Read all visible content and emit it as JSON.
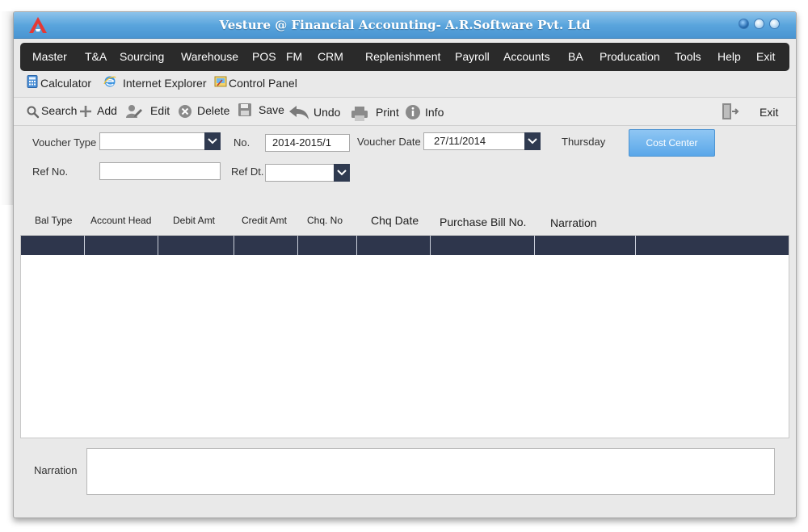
{
  "window": {
    "title": "Vesture @ Financial Accounting- A.R.Software Pvt. Ltd"
  },
  "menu": {
    "items": [
      "Master",
      "T&A",
      "Sourcing",
      "Warehouse",
      "POS",
      "FM",
      "CRM",
      "Replenishment",
      "Payroll",
      "Accounts",
      "BA",
      "Producation",
      "Tools",
      "Help",
      "Exit"
    ]
  },
  "links": {
    "calculator": "Calculator",
    "ie": "Internet Explorer",
    "control_panel": "Control Panel"
  },
  "toolbar": {
    "search": "Search",
    "add": "Add",
    "edit": "Edit",
    "delete": "Delete",
    "save": "Save",
    "undo": "Undo",
    "print": "Print",
    "info": "Info",
    "exit": "Exit"
  },
  "form": {
    "voucher_type_label": "Voucher Type",
    "voucher_type_value": "",
    "no_label": "No.",
    "no_value": "2014-2015/1",
    "voucher_date_label": "Voucher Date",
    "voucher_date_value": "27/11/2014",
    "weekday": "Thursday",
    "cost_center": "Cost Center",
    "ref_no_label": "Ref No.",
    "ref_no_value": "",
    "ref_dt_label": "Ref Dt.",
    "ref_dt_value": ""
  },
  "grid": {
    "columns": [
      "Bal Type",
      "Account Head",
      "Debit Amt",
      "Credit Amt",
      "Chq. No",
      "Chq Date",
      "Purchase Bill No.",
      "Narration"
    ]
  },
  "footer": {
    "narration_label": "Narration",
    "narration_value": ""
  },
  "colors": {
    "title_blue": "#5aa5dd",
    "menubar": "#2a2a2a",
    "grid_header": "#2e364c",
    "button_blue": "#5aa7e9"
  }
}
